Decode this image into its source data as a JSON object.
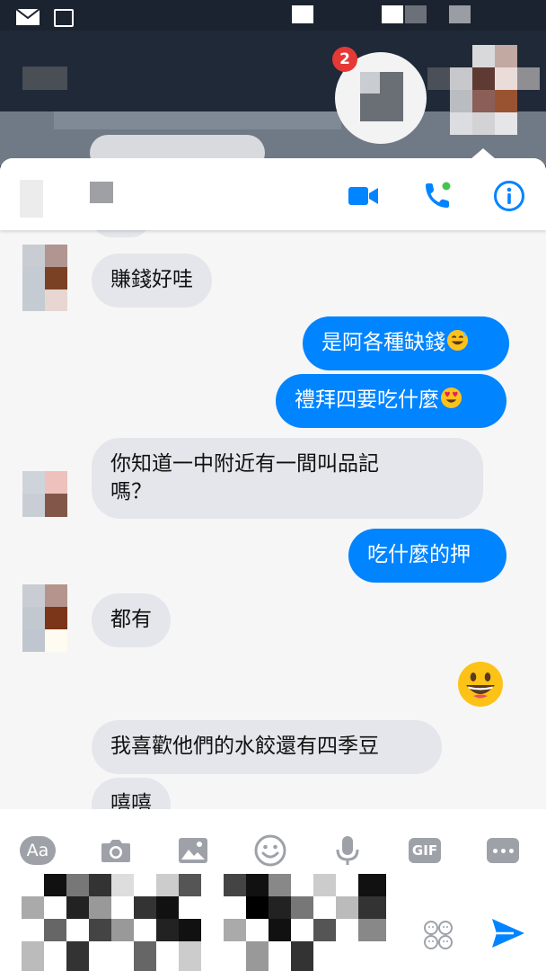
{
  "header": {
    "contact_name": "",
    "unread_badge": "2",
    "video_call_icon": "video-camera-icon",
    "voice_call_icon": "phone-icon",
    "info_icon": "info-icon"
  },
  "messages": [
    {
      "sender": "them",
      "text": "賺錢好哇"
    },
    {
      "sender": "me",
      "text": "是阿各種缺錢",
      "emoji": "grinning-sweat-emoji"
    },
    {
      "sender": "me",
      "text": "禮拜四要吃什麼",
      "emoji": "heart-eyes-emoji"
    },
    {
      "sender": "them",
      "lines": [
        "你知道一中附近有一間叫品記",
        "嗎？"
      ]
    },
    {
      "sender": "me",
      "text": "吃什麼的押"
    },
    {
      "sender": "them",
      "text": "都有"
    },
    {
      "sender": "me",
      "emoji": "grinning-emoji"
    },
    {
      "sender": "them",
      "text": "我喜歡他們的水餃還有四季豆"
    },
    {
      "sender": "them",
      "text": "嘻嘻"
    }
  ],
  "composer": {
    "aa_label": "Aa",
    "gif_label": "GIF",
    "tools": [
      "text-icon",
      "camera-icon",
      "image-icon",
      "emoji-icon",
      "microphone-icon",
      "gif-icon",
      "more-icon"
    ],
    "send_icon": "send-icon",
    "sticker_icon": "sticker-icon"
  },
  "colors": {
    "accent": "#0084ff",
    "incoming_bubble": "#e4e6eb",
    "icon_gray": "#9ea2a8",
    "badge": "#e53935",
    "online_dot": "#44c553"
  }
}
